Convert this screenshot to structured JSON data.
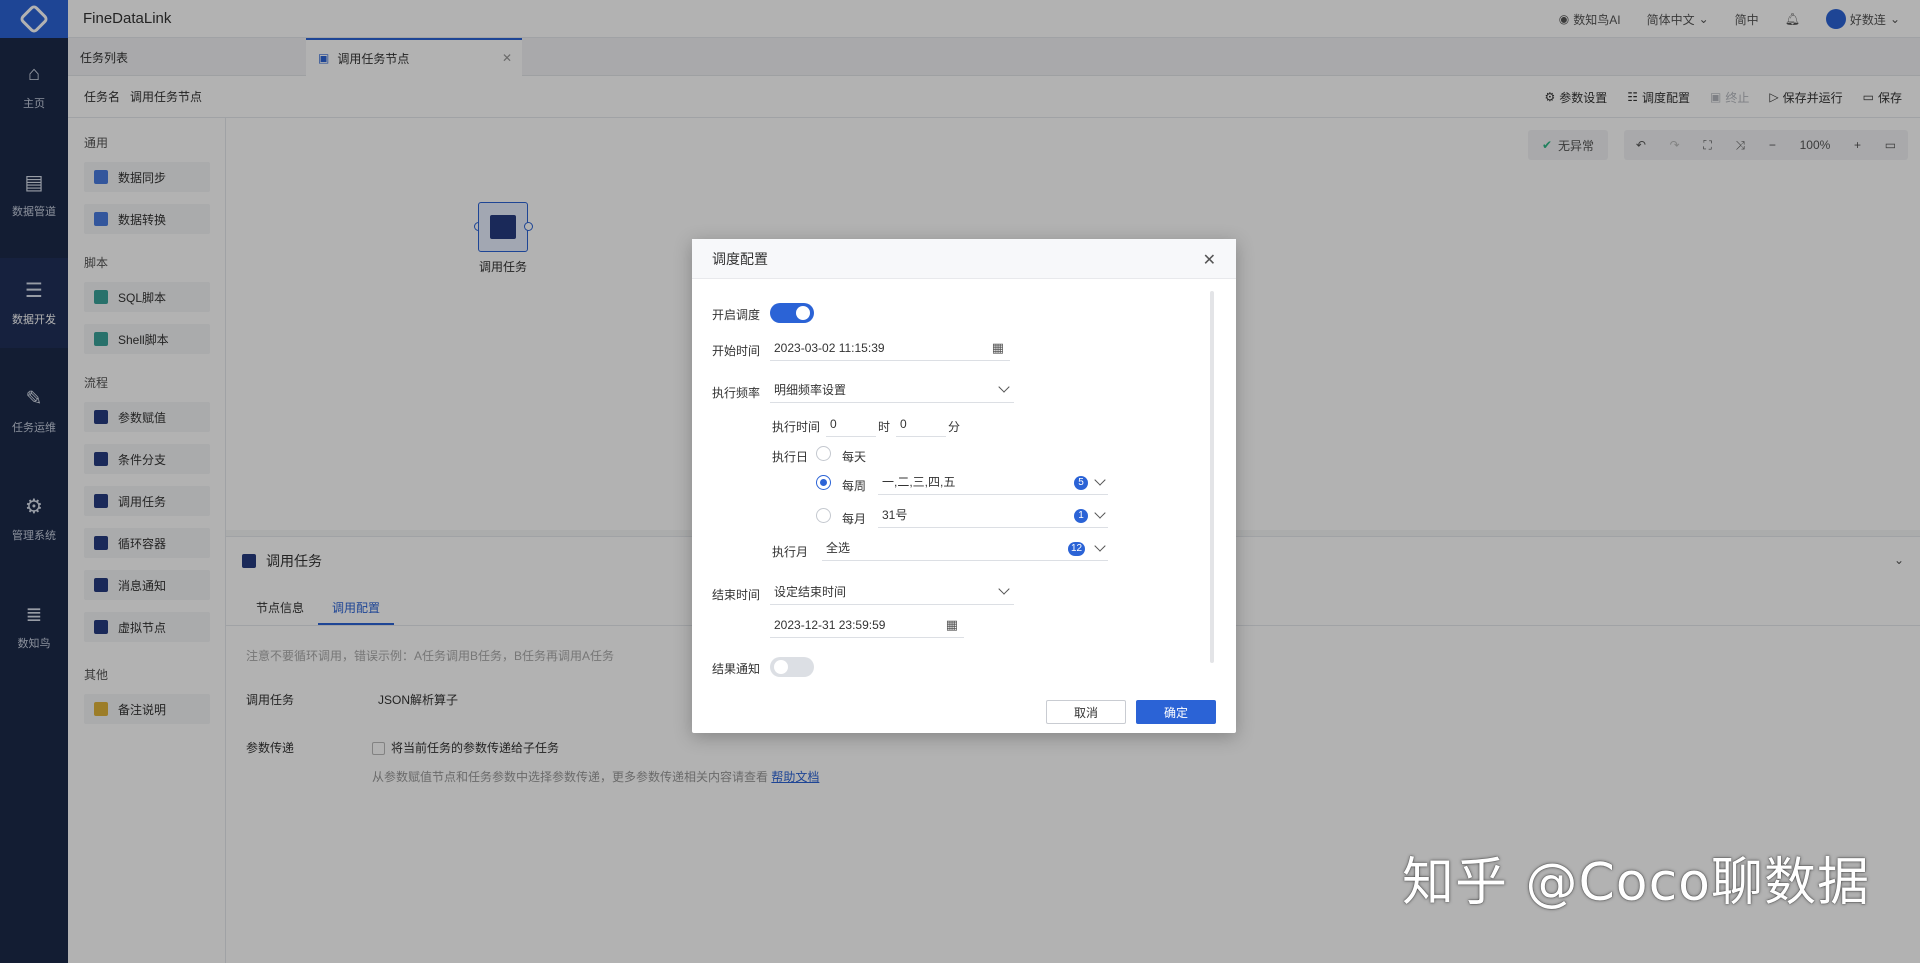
{
  "app": {
    "brand": "FineDataLink"
  },
  "topbar": {
    "ai": "数知鸟AI",
    "language": "简体中文",
    "lang_short": "简中",
    "user": "好数连"
  },
  "leftnav": [
    {
      "label": "主页",
      "icon": "home-icon"
    },
    {
      "label": "数据管道",
      "icon": "pipeline-icon"
    },
    {
      "label": "数据开发",
      "icon": "dev-icon"
    },
    {
      "label": "任务运维",
      "icon": "ops-icon"
    },
    {
      "label": "管理系统",
      "icon": "gear-icon"
    },
    {
      "label": "数知鸟",
      "icon": "list-icon"
    }
  ],
  "tabs": {
    "list": "任务列表",
    "current": "调用任务节点"
  },
  "taskbar": {
    "name_label": "任务名",
    "name_value": "调用任务节点",
    "params": "参数设置",
    "schedule": "调度配置",
    "stop": "终止",
    "save_run": "保存并运行",
    "save": "保存"
  },
  "palette": {
    "groups": [
      "通用",
      "脚本",
      "流程",
      "其他"
    ],
    "items": [
      "数据同步",
      "数据转换",
      "SQL脚本",
      "Shell脚本",
      "参数赋值",
      "条件分支",
      "调用任务",
      "循环容器",
      "消息通知",
      "虚拟节点",
      "备注说明"
    ]
  },
  "canvas": {
    "status": "无异常",
    "zoom": "100%",
    "node_label": "调用任务"
  },
  "bottom": {
    "title": "调用任务",
    "tab_info": "节点信息",
    "tab_config": "调用配置",
    "note": "注意不要循环调用，错误示例：A任务调用B任务，B任务再调用A任务",
    "call_label": "调用任务",
    "call_value": "JSON解析算子",
    "param_label": "参数传递",
    "param_check": "将当前任务的参数传递给子任务",
    "hint": "从参数赋值节点和任务参数中选择参数传递，更多参数传递相关内容请查看",
    "hint_link": "帮助文档"
  },
  "modal": {
    "title": "调度配置",
    "enable_label": "开启调度",
    "enable_on": true,
    "start_label": "开始时间",
    "start_value": "2023-03-02 11:15:39",
    "freq_label": "执行频率",
    "freq_value": "明细频率设置",
    "exec_time_label": "执行时间",
    "hour_value": "0",
    "hour_unit": "时",
    "minute_value": "0",
    "minute_unit": "分",
    "exec_day_label": "执行日",
    "daily": "每天",
    "weekly": "每周",
    "weekly_value": "一,二,三,四,五",
    "weekly_count": "5",
    "monthly": "每月",
    "monthly_value": "31号",
    "monthly_count": "1",
    "exec_month_label": "执行月",
    "month_value": "全选",
    "month_count": "12",
    "end_label": "结束时间",
    "end_mode": "设定结束时间",
    "end_value": "2023-12-31 23:59:59",
    "notify_label": "结果通知",
    "notify_on": false,
    "cancel": "取消",
    "ok": "确定"
  },
  "watermark": "知乎 @Coco聊数据"
}
